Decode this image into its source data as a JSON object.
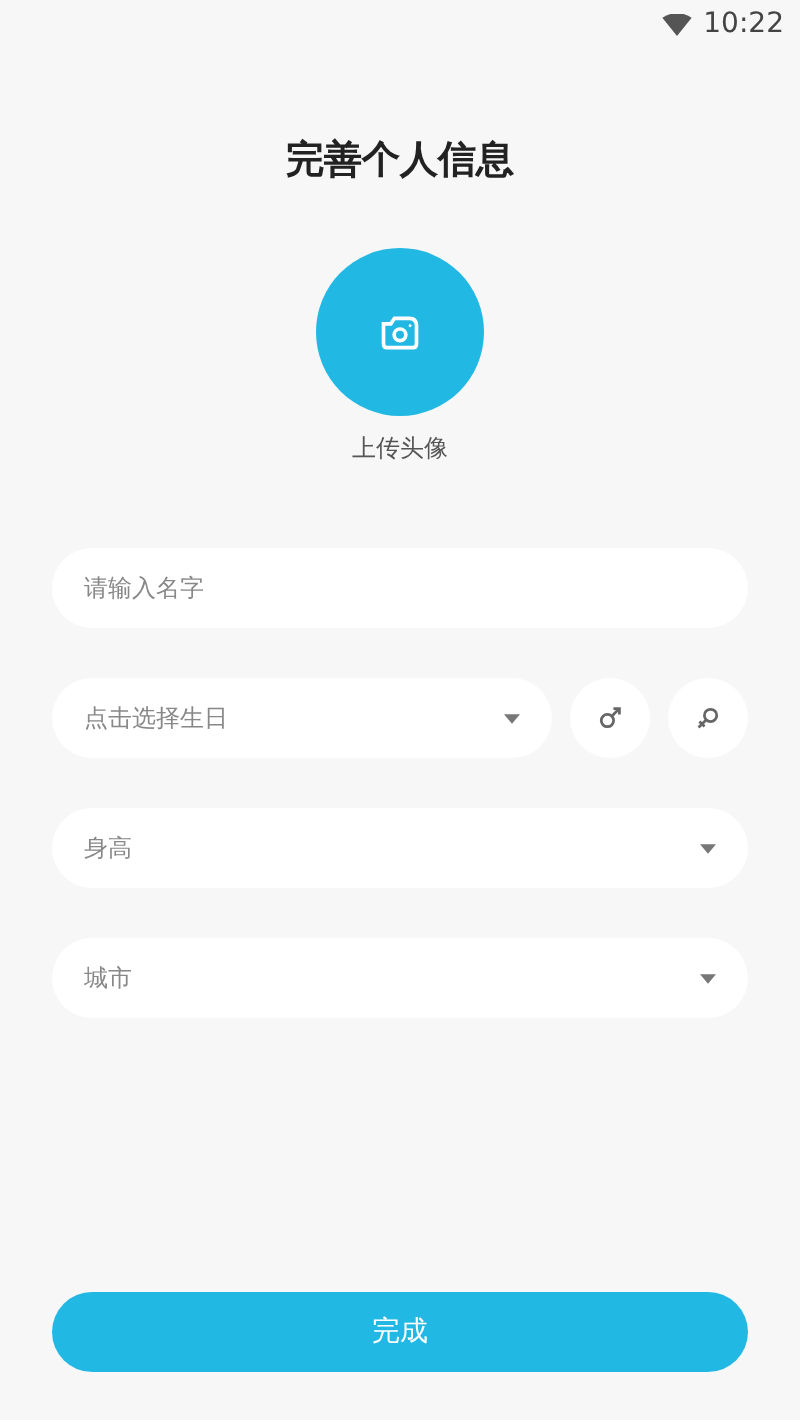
{
  "status_bar": {
    "time": "10:22"
  },
  "title": "完善个人信息",
  "avatar": {
    "label": "上传头像"
  },
  "name_field": {
    "placeholder": "请输入名字"
  },
  "birthday": {
    "placeholder": "点击选择生日"
  },
  "gender_buttons": [
    {
      "kind": "male"
    },
    {
      "kind": "female"
    }
  ],
  "selects": [
    {
      "placeholder": "身高"
    },
    {
      "placeholder": "城市"
    }
  ],
  "submit": {
    "label": "完成"
  }
}
